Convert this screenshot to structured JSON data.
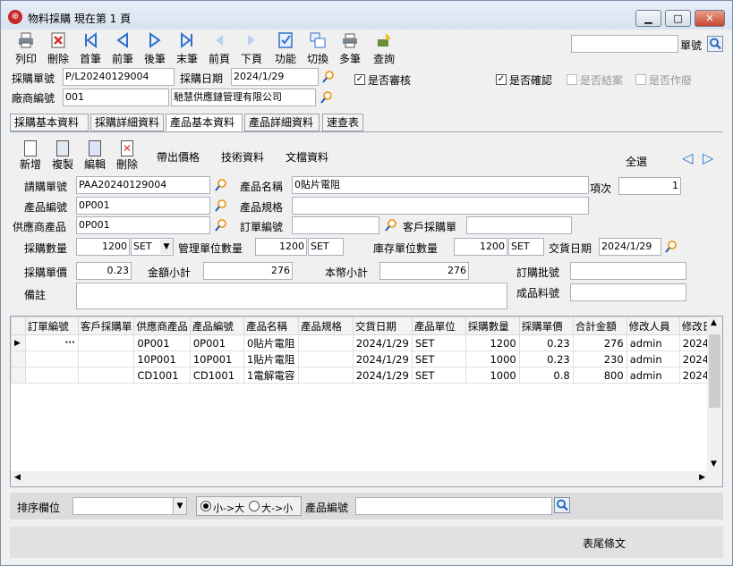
{
  "window": {
    "title": "物料採購  現在第 1 頁",
    "minimize": "▁",
    "maximize": "□",
    "close": "✕"
  },
  "toolbar": [
    {
      "label": "列印",
      "icon": "printer-icon"
    },
    {
      "label": "刪除",
      "icon": "delete-icon"
    },
    {
      "label": "首筆",
      "icon": "first-record-icon"
    },
    {
      "label": "前筆",
      "icon": "previous-record-icon"
    },
    {
      "label": "後筆",
      "icon": "next-record-icon"
    },
    {
      "label": "末筆",
      "icon": "last-record-icon"
    },
    {
      "label": "前頁",
      "icon": "previous-page-icon"
    },
    {
      "label": "下頁",
      "icon": "next-page-icon"
    },
    {
      "label": "功能",
      "icon": "function-icon"
    },
    {
      "label": "切換",
      "icon": "switch-icon"
    },
    {
      "label": "多筆",
      "icon": "multi-record-icon"
    },
    {
      "label": "查詢",
      "icon": "query-icon"
    }
  ],
  "search": {
    "value": "",
    "label": "單號"
  },
  "header": {
    "po_no_label": "採購單號",
    "po_no": "P/L20240129004",
    "po_date_label": "採購日期",
    "po_date": "2024/1/29",
    "review_label": "是否審核",
    "review_checked": "✓",
    "confirm_label": "是否確認",
    "confirm_checked": "✓",
    "closed_label": "是否結案",
    "void_label": "是否作廢",
    "vendor_label": "廠商編號",
    "vendor_no": "001",
    "vendor_name": "馳慧供應鏈管理有限公司"
  },
  "tabs": [
    "採購基本資料",
    "採購詳細資料",
    "產品基本資料",
    "產品詳細資料",
    "速查表"
  ],
  "subtoolbar": {
    "new": "新增",
    "copy": "複製",
    "edit": "編輯",
    "delete": "刪除",
    "price": "帶出價格",
    "tech": "技術資料",
    "docs": "文檔資料",
    "select_all": "全選"
  },
  "form": {
    "req_no_label": "請購單號",
    "req_no": "PAA20240129004",
    "prod_name_label": "產品名稱",
    "prod_name": "0貼片電阻",
    "item_label": "項次",
    "item": "1",
    "prod_no_label": "產品編號",
    "prod_no": "0P001",
    "spec_label": "產品規格",
    "spec": "",
    "supplier_prod_label": "供應商產品",
    "supplier_prod": "0P001",
    "order_no_label": "訂單編號",
    "order_no": "",
    "cust_po_label": "客戶採購單",
    "cust_po": "",
    "qty_label": "採購數量",
    "qty": "1200",
    "qty_unit": "SET",
    "mgmt_qty_label": "管理單位數量",
    "mgmt_qty": "1200",
    "mgmt_unit": "SET",
    "stock_qty_label": "庫存單位數量",
    "stock_qty": "1200",
    "stock_unit": "SET",
    "delivery_label": "交貨日期",
    "delivery": "2024/1/29",
    "price_label": "採購單價",
    "price": "0.23",
    "subtotal_label": "金額小計",
    "subtotal": "276",
    "local_subtotal_label": "本幣小計",
    "local_subtotal": "276",
    "lot_label": "訂購批號",
    "lot": "",
    "remark_label": "備註",
    "remark": "",
    "finished_label": "成品料號",
    "finished": ""
  },
  "grid": {
    "columns": [
      "訂單編號",
      "客戶採購單",
      "供應商產品",
      "產品編號",
      "產品名稱",
      "產品規格",
      "交貨日期",
      "產品單位",
      "採購數量",
      "採購單價",
      "合計金額",
      "修改人員",
      "修改日"
    ],
    "rows": [
      [
        "",
        "",
        "0P001",
        "0P001",
        "0貼片電阻",
        "",
        "2024/1/29",
        "SET",
        "1200",
        "0.23",
        "276",
        "admin",
        "2024/"
      ],
      [
        "",
        "",
        "10P001",
        "10P001",
        "1貼片電阻",
        "",
        "2024/1/29",
        "SET",
        "1000",
        "0.23",
        "230",
        "admin",
        "2024/"
      ],
      [
        "",
        "",
        "CD1001",
        "CD1001",
        "1電解電容",
        "",
        "2024/1/29",
        "SET",
        "1000",
        "0.8",
        "800",
        "admin",
        "2024/"
      ]
    ]
  },
  "sortbar": {
    "label": "排序欄位",
    "asc": "小->大",
    "desc": "大->小",
    "field_label": "產品編號",
    "field_value": ""
  },
  "status": {
    "text": "表尾條文"
  }
}
